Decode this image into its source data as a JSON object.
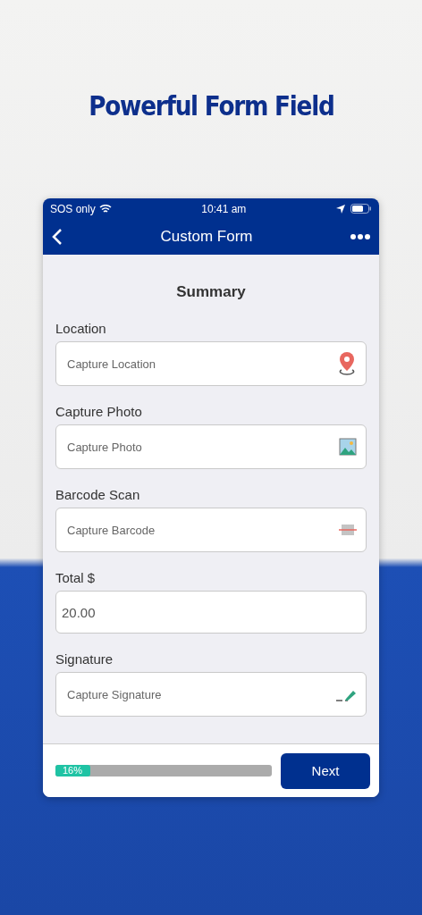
{
  "headline": "Powerful Form Field",
  "status_bar": {
    "carrier": "SOS only",
    "time": "10:41 am"
  },
  "nav": {
    "title": "Custom Form"
  },
  "section_title": "Summary",
  "fields": [
    {
      "kind": "location",
      "label": "Location",
      "placeholder": "Capture Location"
    },
    {
      "kind": "photo",
      "label": "Capture Photo",
      "placeholder": "Capture Photo"
    },
    {
      "kind": "barcode",
      "label": "Barcode Scan",
      "placeholder": "Capture Barcode"
    },
    {
      "kind": "number",
      "label": "Total $",
      "value": "20.00"
    },
    {
      "kind": "signature",
      "label": "Signature",
      "placeholder": "Capture Signature"
    }
  ],
  "progress": {
    "level": 0.16,
    "reading": "16%"
  },
  "next_button": "Next"
}
